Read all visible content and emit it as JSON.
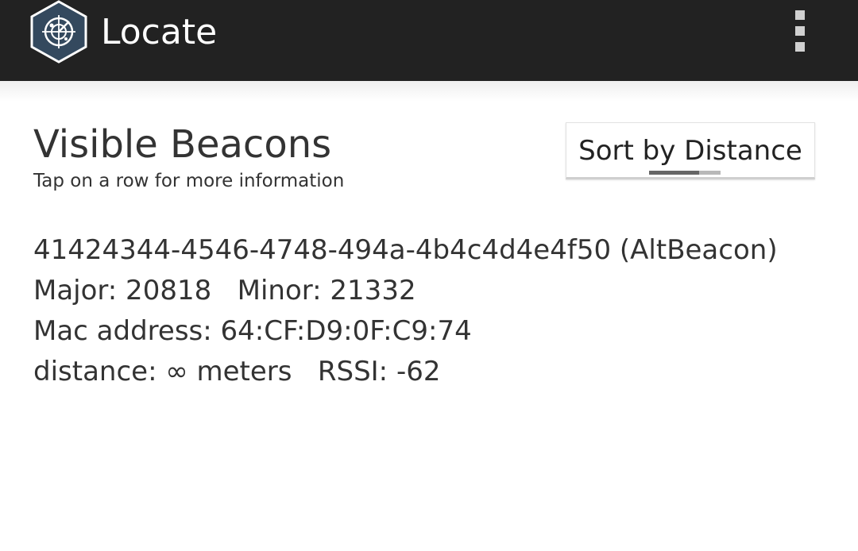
{
  "app_bar": {
    "title": "Locate",
    "logo_icon": "radar-hexagon-icon",
    "menu_icon": "overflow-menu-icon",
    "background": "#222222",
    "logo_color": "#34495e"
  },
  "header": {
    "title": "Visible Beacons",
    "subtitle": "Tap on a row for more information"
  },
  "sort_button": {
    "label": "Sort by Distance"
  },
  "beacons": [
    {
      "uuid_line": "41424344-4546-4748-494a-4b4c4d4e4f50 (AltBeacon)",
      "ids_line": "Major: 20818   Minor: 21332",
      "mac_line": "Mac address: 64:CF:D9:0F:C9:74",
      "distance_line": "distance: ∞ meters   RSSI: -62"
    }
  ]
}
